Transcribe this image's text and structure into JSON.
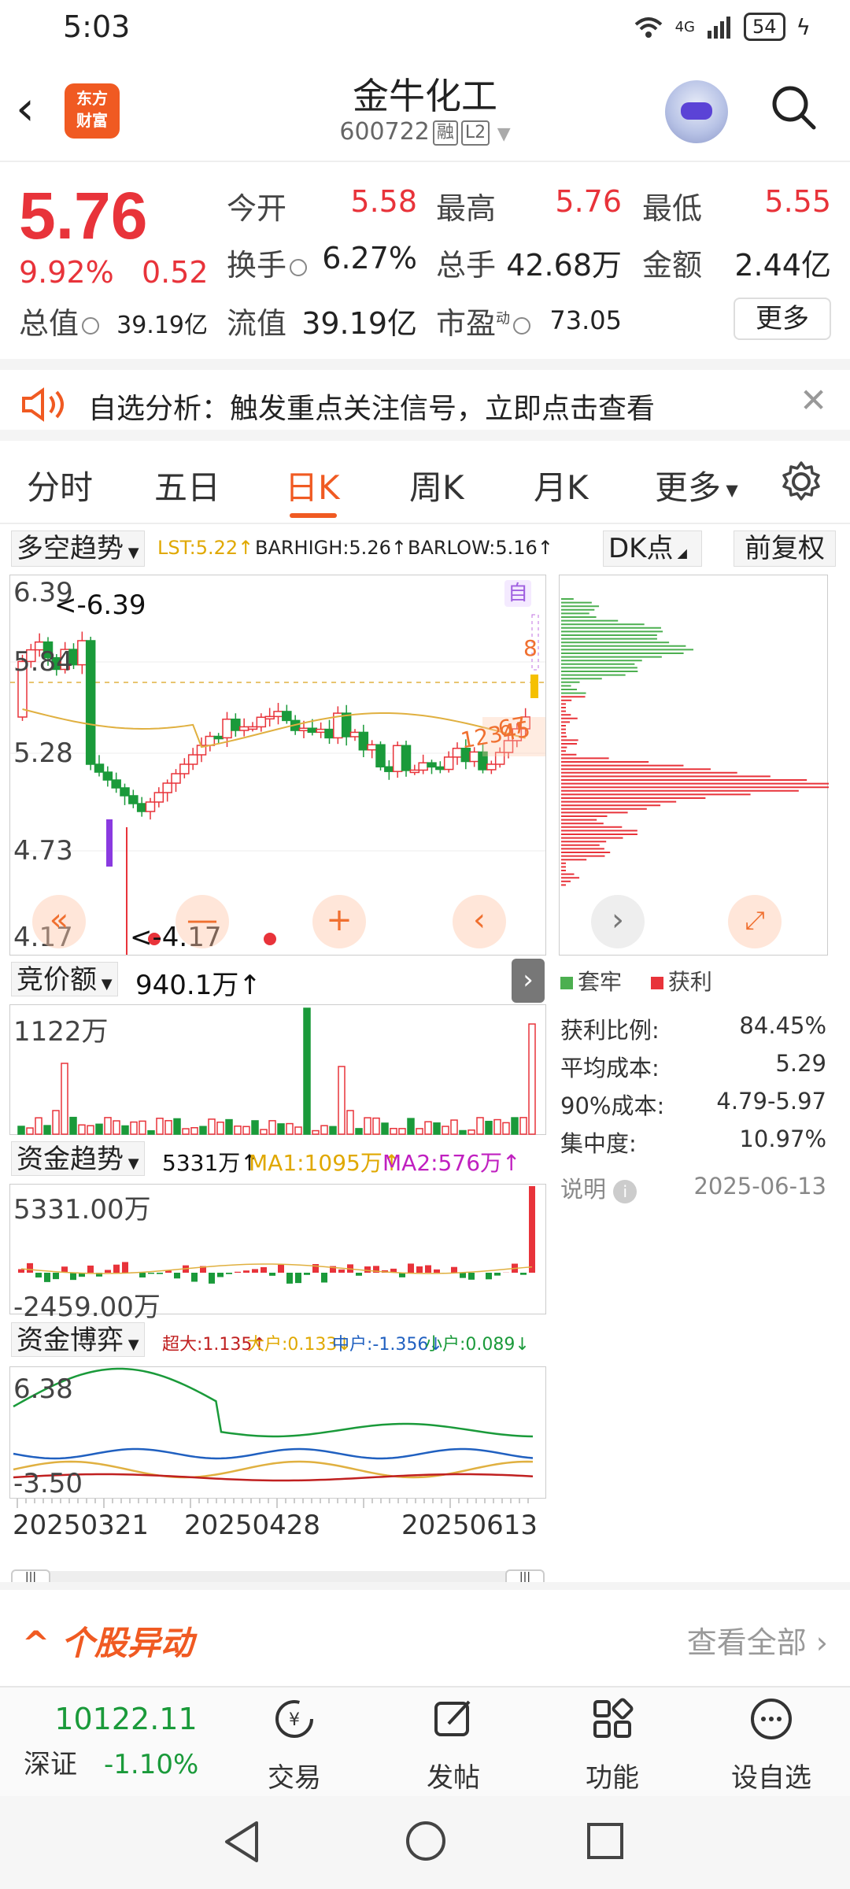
{
  "status": {
    "time": "5:03",
    "network": "4G",
    "battery": "54"
  },
  "header": {
    "brand_logo": "东方财富",
    "stock_name": "金牛化工",
    "code": "600722",
    "tag1": "融",
    "tag2": "L2"
  },
  "quote": {
    "price": "5.76",
    "pct": "9.92%",
    "change": "0.52",
    "open_label": "今开",
    "open": "5.58",
    "high_label": "最高",
    "high": "5.76",
    "low_label": "最低",
    "low": "5.55",
    "turnover_label": "换手",
    "turnover": "6.27%",
    "volume_label": "总手",
    "volume": "42.68万",
    "amount_label": "金额",
    "amount": "2.44亿",
    "mktcap_label": "总值",
    "mktcap": "39.19亿",
    "float_label": "流值",
    "float": "39.19亿",
    "pe_label": "市盈",
    "pe_sup": "动",
    "pe": "73.05",
    "more": "更多"
  },
  "alert": {
    "text": "自选分析：触发重点关注信号，立即点击查看"
  },
  "tabs": [
    "分时",
    "五日",
    "日K",
    "周K",
    "月K",
    "更多"
  ],
  "active_tab": "日K",
  "chart_toolbar": {
    "indicator": "多空趋势",
    "lst": "LST:5.22↑",
    "barhigh": "BARHIGH:5.26↑",
    "barlow": "BARLOW:5.16↑",
    "dk_btn": "DK点",
    "adjust_btn": "前复权"
  },
  "kline": {
    "y_labels": [
      "6.39",
      "5.84",
      "5.28",
      "4.73",
      "4.17"
    ],
    "max_marker": "<-6.39",
    "min_marker": "<-4.17",
    "auto_badge": "自",
    "signal_nums": "12345",
    "signal_nums2": "67",
    "signal_8": "8"
  },
  "auction": {
    "selector": "竞价额",
    "value": "940.1万↑",
    "y_label": "1122万"
  },
  "fund_trend": {
    "selector": "资金趋势",
    "value": "5331万↑",
    "ma1": "MA1:1095万↑",
    "ma2": "MA2:576万↑",
    "y_top": "5331.00万",
    "y_bottom": "-2459.00万"
  },
  "fund_game": {
    "selector": "资金博弈",
    "super": "超大:1.135↑",
    "large": "大户:0.133↓",
    "medium": "中户:-1.356↓",
    "small": "小户:0.089↓",
    "y_top": "6.38",
    "y_bottom": "-3.50"
  },
  "x_dates": [
    "20250321",
    "20250428",
    "20250613"
  ],
  "chip": {
    "legend_trapped": "套牢",
    "legend_profit": "获利",
    "stats": [
      {
        "label": "获利比例:",
        "value": "84.45%"
      },
      {
        "label": "平均成本:",
        "value": "5.29"
      },
      {
        "label": "90%成本:",
        "value": "4.79-5.97"
      },
      {
        "label": "集中度:",
        "value": "10.97%"
      }
    ],
    "note_label": "说明",
    "date": "2025-06-13"
  },
  "movers": {
    "title": "个股异动",
    "view_all": "查看全部"
  },
  "bottom_nav": {
    "index_value": "10122.11",
    "index_name": "深证",
    "index_pct": "-1.10%",
    "items": [
      "交易",
      "发帖",
      "功能",
      "设自选"
    ]
  },
  "colors": {
    "up": "#e8333a",
    "down": "#1a9a3a",
    "accent": "#f05a22"
  }
}
